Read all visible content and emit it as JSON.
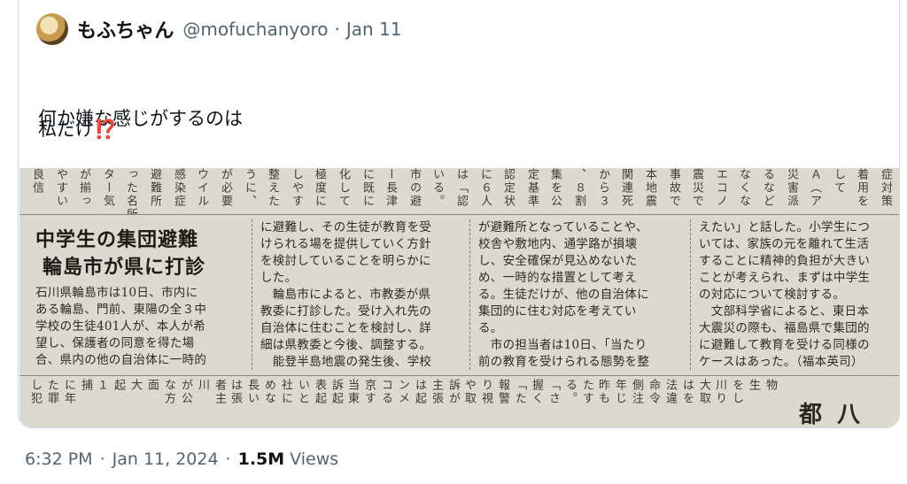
{
  "quoted_tweet": {
    "author_name": "もふちゃん",
    "author_handle": "@mofuchanyoro",
    "separator": "·",
    "date": "Jan 11",
    "text_line1": "何か嫌な感じがするのは",
    "text_line2": "私だけ",
    "text_emoji": "⁉️"
  },
  "newspaper": {
    "headline_line1": "中学生の集団避難",
    "headline_line2": "輪島市が県に打診",
    "columns": [
      [
        "石川県輪島市は10日、市内に",
        "ある輪島、門前、東陽の全３中",
        "学校の生徒401人が、本人が希",
        "望し、保護者の同意を得た場",
        "合、県内の他の自治体に一時的"
      ],
      [
        "に避難し、その生徒が教育を受",
        "けられる場を提供していく方針",
        "を検討していることを明らかに",
        "した。",
        "　輪島市によると、市教委が県",
        "教委に打診した。受け入れ先の",
        "自治体に住むことを検討し、詳",
        "細は県教委と今後、調整する。",
        "　能登半島地震の発生後、学校"
      ],
      [
        "が避難所となっていることや、",
        "校舎や敷地内、通学路が損壊",
        "し、安全確保が見込めないた",
        "め、一時的な措置として考え",
        "る。生徒だけが、他の自治体に",
        "集団的に住む対応を考えてい",
        "る。",
        "　市の担当者は10日、「当たり",
        "前の教育を受けられる態勢を整"
      ],
      [
        "えたい」と話した。小学生につ",
        "いては、家族の元を離れて生活",
        "することに精神的負担が大きい",
        "ことが考えられ、まずは中学生",
        "の対応について検討する。",
        "　文部科学省によると、東日本",
        "大震災の際も、福島県で集団的",
        "に避難して教育を受ける同様の",
        "ケースはあった。（福本英司）"
      ]
    ],
    "top_strip_columns": [
      "良信",
      "やすい",
      "が揃っ",
      "ター気",
      "った名所",
      "避難所",
      "感染症",
      "ウイル",
      "が必要",
      "うに、",
      "整えた",
      "しやす",
      "極度に",
      "化して",
      "に既に",
      "ー長津",
      "市の避",
      "いる。",
      "は「認",
      "に６人",
      "認定状",
      "定基準",
      "集を公",
      "、８割",
      "から３",
      "関連死",
      "本地震",
      "事故で",
      "震災で",
      "エコノ",
      "なくな",
      "るなど",
      "災害派",
      "Ａ（ア",
      "して",
      "着用を",
      "症対策"
    ],
    "bottom_strip_columns": [
      "し犯",
      "た罪",
      "に年",
      "捕",
      "１",
      "起",
      "大",
      "面",
      "な方",
      "が公",
      "川",
      "者主",
      "は張",
      "長い",
      "めな",
      "社に",
      "いと",
      "表起",
      "訴起",
      "当東",
      "京す",
      "コる",
      "ンメ",
      "は起",
      "主張",
      "訴が",
      "や取",
      "り視",
      "報警",
      "「た",
      "握く",
      "「さ",
      "る。",
      "たす",
      "昨も",
      "年じ",
      "側注",
      "命令",
      "法違",
      "はを",
      "大取",
      "川り",
      "をし",
      "生",
      "物"
    ],
    "bottom_big_text": "都 八"
  },
  "footer": {
    "time": "6:32 PM",
    "separator": "·",
    "date": "Jan 11, 2024",
    "views_count": "1.5M",
    "views_label": "Views"
  }
}
